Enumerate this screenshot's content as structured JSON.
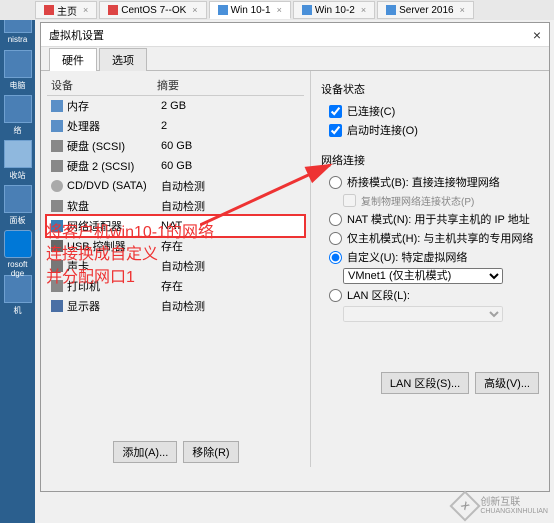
{
  "tabs": {
    "home": "主页",
    "centos": "CentOS 7--OK",
    "win10_1": "Win 10-1",
    "win10_2": "Win 10-2",
    "server2016": "Server 2016"
  },
  "dialog": {
    "title": "虚拟机设置",
    "tab_hardware": "硬件",
    "tab_options": "选项",
    "col_device": "设备",
    "col_summary": "摘要"
  },
  "devices": [
    {
      "name": "内存",
      "value": "2 GB",
      "ico": "mem"
    },
    {
      "name": "处理器",
      "value": "2",
      "ico": "cpu"
    },
    {
      "name": "硬盘 (SCSI)",
      "value": "60 GB",
      "ico": "disk"
    },
    {
      "name": "硬盘 2 (SCSI)",
      "value": "60 GB",
      "ico": "disk"
    },
    {
      "name": "CD/DVD (SATA)",
      "value": "自动检测",
      "ico": "cd"
    },
    {
      "name": "软盘",
      "value": "自动检测",
      "ico": "disk"
    },
    {
      "name": "网络适配器",
      "value": "NAT",
      "ico": "net",
      "selected": true
    },
    {
      "name": "USB 控制器",
      "value": "存在",
      "ico": "usb"
    },
    {
      "name": "声卡",
      "value": "自动检测",
      "ico": "sound"
    },
    {
      "name": "打印机",
      "value": "存在",
      "ico": "printer"
    },
    {
      "name": "显示器",
      "value": "自动检测",
      "ico": "display"
    }
  ],
  "right": {
    "device_status": "设备状态",
    "connected": "已连接(C)",
    "connect_at_poweron": "启动时连接(O)",
    "net_connection": "网络连接",
    "bridged": "桥接模式(B): 直接连接物理网络",
    "replicate": "复制物理网络连接状态(P)",
    "nat": "NAT 模式(N): 用于共享主机的 IP 地址",
    "hostonly": "仅主机模式(H): 与主机共享的专用网络",
    "custom": "自定义(U): 特定虚拟网络",
    "custom_select": "VMnet1 (仅主机模式)",
    "lanseg": "LAN 区段(L):",
    "btn_lanseg": "LAN 区段(S)...",
    "btn_advanced": "高级(V)..."
  },
  "footer": {
    "add": "添加(A)...",
    "remove": "移除(R)"
  },
  "annotation": {
    "line1": "将客户机win10-1的网络",
    "line2": "连接换成自定义",
    "line3": "并分配网口1"
  },
  "desktop": {
    "admin": "nistra",
    "computer": "电脑",
    "network": "络",
    "recycle": "收站",
    "panel": "面板",
    "edge1": "rosoft",
    "edge2": "dge",
    "task": "机"
  },
  "watermark": {
    "brand": "创新互联",
    "en": "CHUANGXINHULIAN"
  }
}
